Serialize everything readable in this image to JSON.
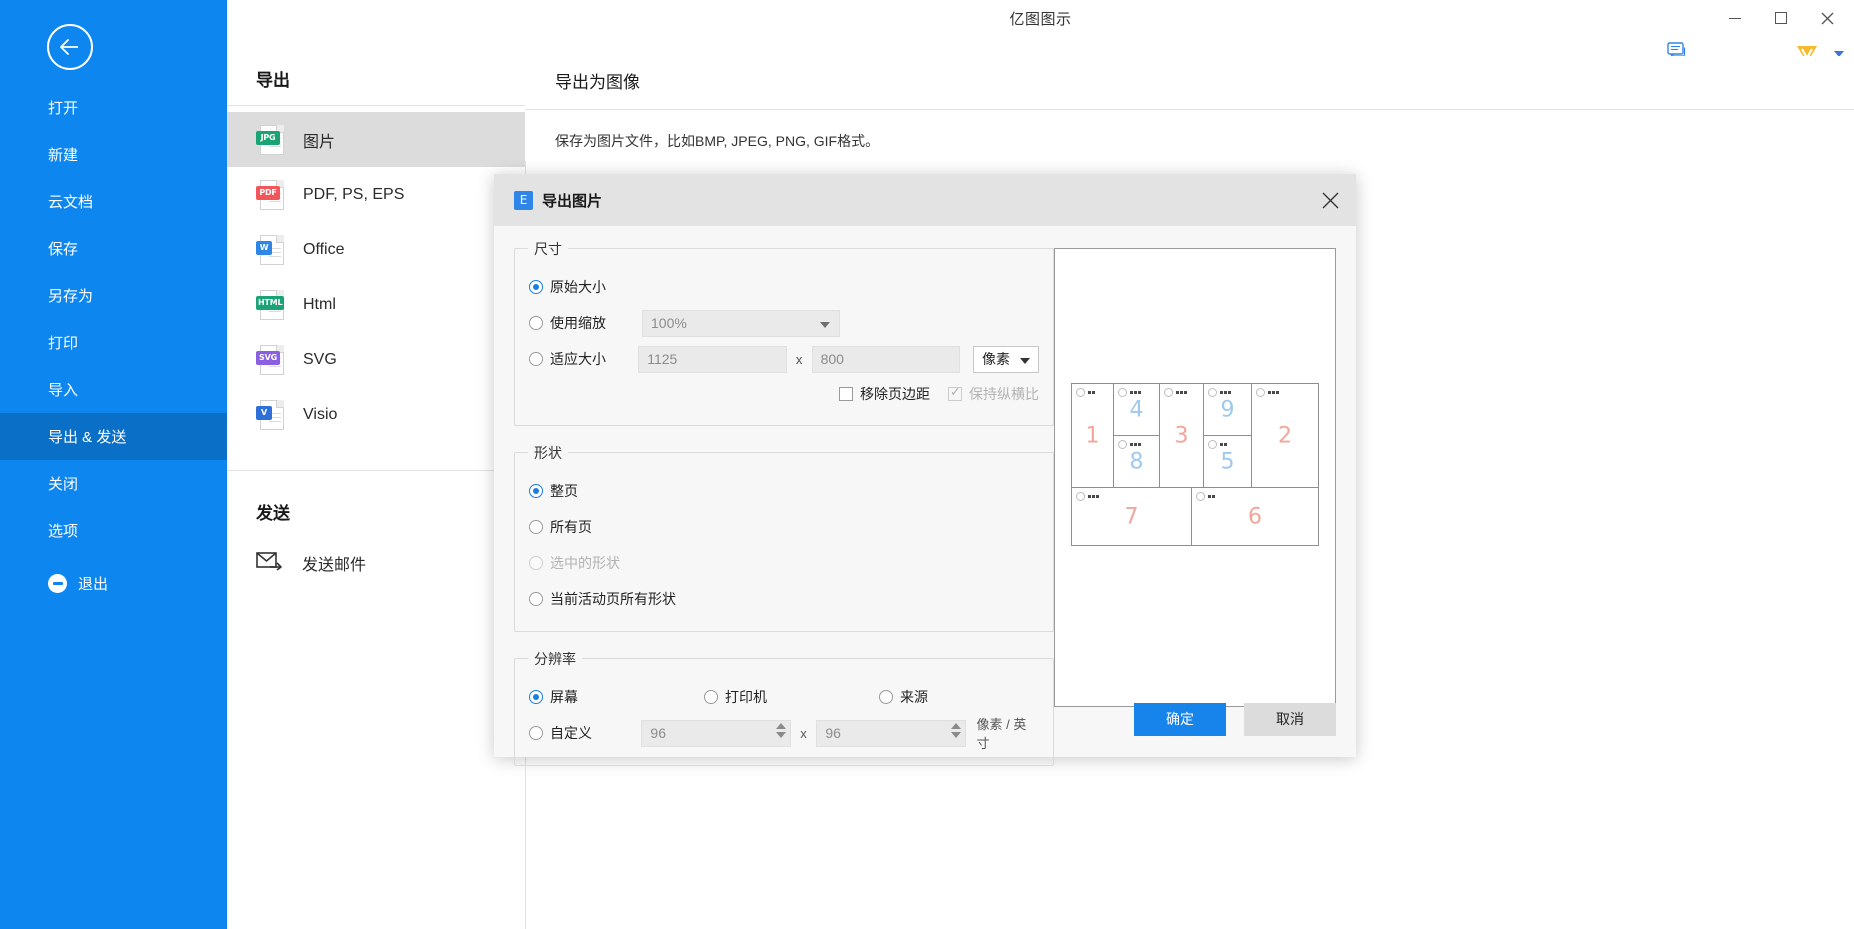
{
  "window": {
    "title": "亿图图示",
    "minimize_label": "最小化",
    "maximize_label": "最大化",
    "close_label": "关闭",
    "more_label": "...",
    "vip_letter": "V"
  },
  "sidebar": {
    "back_label": "返回",
    "items": [
      {
        "label": "打开",
        "active": false
      },
      {
        "label": "新建",
        "active": false
      },
      {
        "label": "云文档",
        "active": false
      },
      {
        "label": "保存",
        "active": false
      },
      {
        "label": "另存为",
        "active": false
      },
      {
        "label": "打印",
        "active": false
      },
      {
        "label": "导入",
        "active": false
      },
      {
        "label": "导出 & 发送",
        "active": true
      },
      {
        "label": "关闭",
        "active": false
      },
      {
        "label": "选项",
        "active": false
      }
    ],
    "exit_label": "退出"
  },
  "export_column": {
    "heading": "导出",
    "formats": [
      {
        "label": "图片",
        "tag": "JPG",
        "color": "#1aa374",
        "selected": true
      },
      {
        "label": "PDF, PS, EPS",
        "tag": "PDF",
        "color": "#f2555a",
        "selected": false
      },
      {
        "label": "Office",
        "tag": "W",
        "color": "#2f86e8",
        "selected": false
      },
      {
        "label": "Html",
        "tag": "HTML",
        "color": "#1aa374",
        "selected": false
      },
      {
        "label": "SVG",
        "tag": "SVG",
        "color": "#8a5fe0",
        "selected": false
      },
      {
        "label": "Visio",
        "tag": "V",
        "color": "#2f6fd8",
        "selected": false
      }
    ],
    "send_heading": "发送",
    "send_mail_label": "发送邮件"
  },
  "detail": {
    "title": "导出为图像",
    "description": "保存为图片文件，比如BMP, JPEG, PNG, GIF格式。"
  },
  "dialog": {
    "title": "导出图片",
    "app_icon_letter": "E",
    "close_label": "×",
    "size": {
      "legend": "尺寸",
      "original_label": "原始大小",
      "original_selected": true,
      "scale_label": "使用缩放",
      "scale_selected": false,
      "scale_value": "100%",
      "fit_label": "适应大小",
      "fit_selected": false,
      "width_value": "1125",
      "height_value": "800",
      "x_separator": "x",
      "unit_value": "像素",
      "remove_margin_label": "移除页边距",
      "remove_margin_checked": false,
      "keep_ratio_label": "保持纵横比",
      "keep_ratio_checked": true,
      "keep_ratio_disabled": true
    },
    "shape": {
      "legend": "形状",
      "options": [
        {
          "label": "整页",
          "selected": true,
          "disabled": false
        },
        {
          "label": "所有页",
          "selected": false,
          "disabled": false
        },
        {
          "label": "选中的形状",
          "selected": false,
          "disabled": true
        },
        {
          "label": "当前活动页所有形状",
          "selected": false,
          "disabled": false
        }
      ]
    },
    "resolution": {
      "legend": "分辨率",
      "options": [
        {
          "label": "屏幕",
          "selected": true
        },
        {
          "label": "打印机",
          "selected": false
        },
        {
          "label": "来源",
          "selected": false
        }
      ],
      "custom_label": "自定义",
      "custom_selected": false,
      "dpi_x": "96",
      "dpi_y": "96",
      "x_separator": "x",
      "dpi_unit": "像素 / 英寸"
    },
    "preview": {
      "top_cells": [
        {
          "num": "1",
          "color": "red"
        },
        {
          "num": "4",
          "color": "blue",
          "stacked_with": "8"
        },
        {
          "num": "8",
          "color": "blue"
        },
        {
          "num": "3",
          "color": "red"
        },
        {
          "num": "9",
          "color": "blue",
          "stacked_with": "5"
        },
        {
          "num": "5",
          "color": "blue"
        },
        {
          "num": "2",
          "color": "red"
        }
      ],
      "bottom_cells": [
        {
          "num": "7",
          "color": "red"
        },
        {
          "num": "6",
          "color": "red"
        }
      ]
    },
    "ok_label": "确定",
    "cancel_label": "取消"
  },
  "colors": {
    "brand_blue": "#0d86ef",
    "accent_button": "#1784ec",
    "sidebar_active": "#0a6fc7",
    "selected_row": "#dcdcdc"
  }
}
